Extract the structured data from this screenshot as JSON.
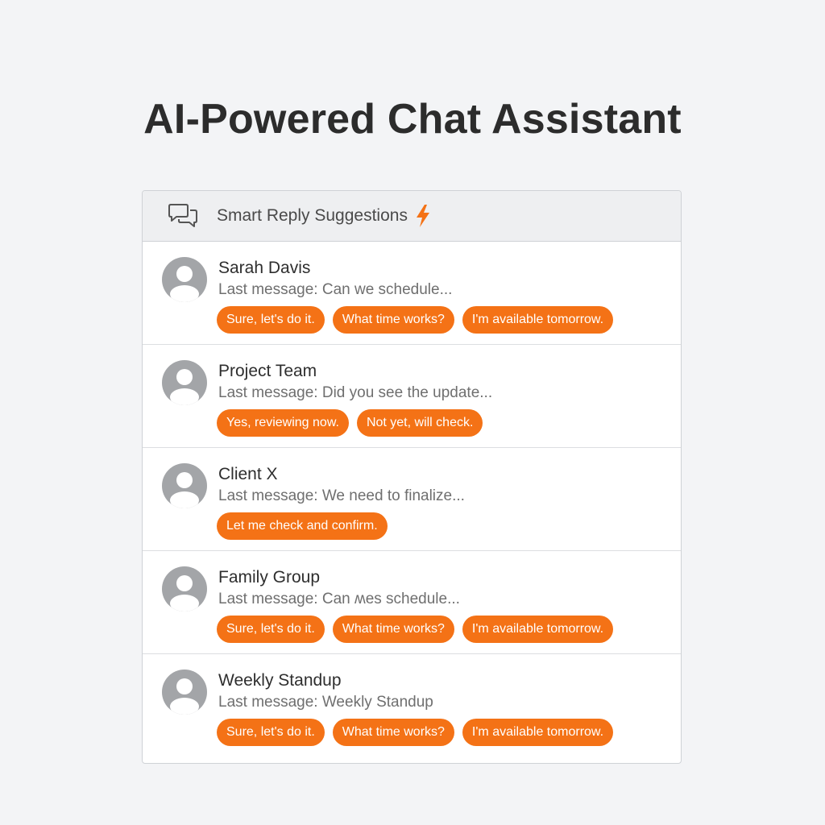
{
  "page": {
    "title": "AI-Powered Chat Assistant"
  },
  "panel": {
    "header": {
      "icon": "chat-bubbles-icon",
      "title": "Smart Reply Suggestions",
      "badge_icon": "lightning-bolt-icon"
    },
    "conversations": [
      {
        "name": "Sarah Davis",
        "last_message": "Last message: Can we schedule...",
        "suggestions": [
          "Sure, let's do it.",
          "What time works?",
          "I'm available tomorrow."
        ]
      },
      {
        "name": "Project Team",
        "last_message": "Last message: Did you see the update...",
        "suggestions": [
          "Yes, reviewing now.",
          "Not yet, will check."
        ]
      },
      {
        "name": "Client X",
        "last_message": "Last message: We need to finalize...",
        "suggestions": [
          "Let me check and confirm."
        ]
      },
      {
        "name": "Family Group",
        "last_message": "Last message: Can ʍes schedule...",
        "suggestions": [
          "Sure, let's do it.",
          "What time works?",
          "I'm available tomorrow."
        ]
      },
      {
        "name": "Weekly Standup",
        "last_message": "Last message: Weekly Standup",
        "suggestions": [
          "Sure, let's do it.",
          "What time works?",
          "I'm available tomorrow."
        ]
      }
    ]
  },
  "colors": {
    "accent": "#f47216",
    "avatar": "#a3a5a8",
    "background": "#f3f4f6"
  }
}
